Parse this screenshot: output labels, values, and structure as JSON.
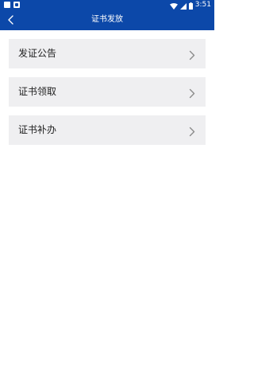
{
  "status_bar": {
    "time": "3:51",
    "icons": [
      "gallery-notification-icon",
      "a-notification-icon",
      "wifi-icon",
      "signal-icon",
      "battery-icon"
    ]
  },
  "header": {
    "title": "证书发放",
    "back_icon": "chevron-left-icon"
  },
  "menu": {
    "items": [
      {
        "label": "发证公告",
        "icon": "chevron-right-icon"
      },
      {
        "label": "证书领取",
        "icon": "chevron-right-icon"
      },
      {
        "label": "证书补办",
        "icon": "chevron-right-icon"
      }
    ]
  },
  "colors": {
    "header_bg": "#0c48a9",
    "item_bg": "#efeff1",
    "chevron": "#8a8a8a",
    "text": "#222222"
  }
}
